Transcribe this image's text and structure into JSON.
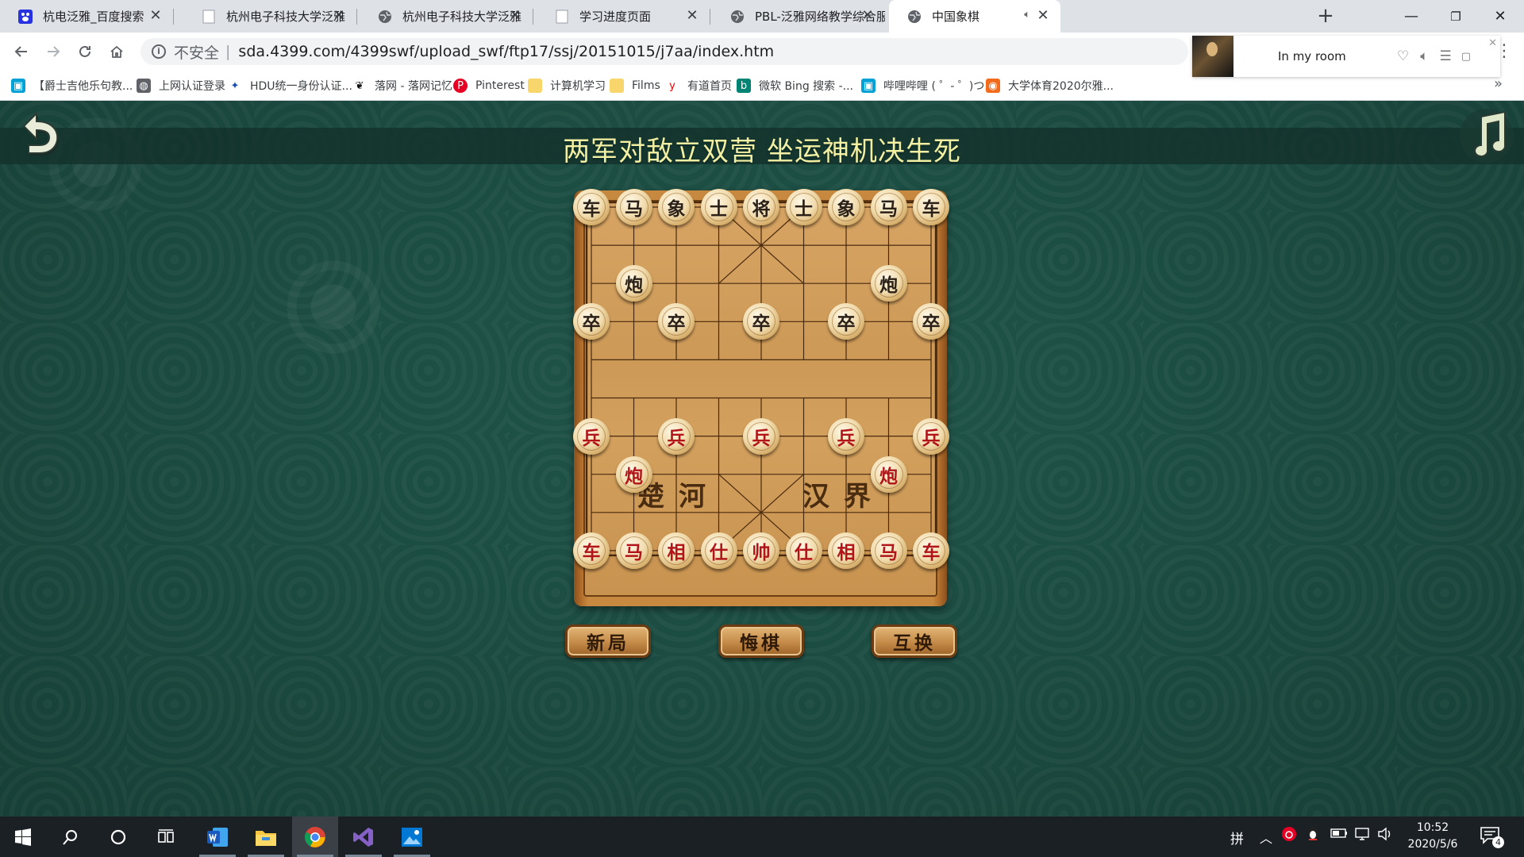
{
  "browser": {
    "tabs": [
      {
        "title": "杭电泛雅_百度搜索",
        "favicon": "baidu-paw-icon",
        "active": false
      },
      {
        "title": "杭州电子科技大学泛雅",
        "favicon": "blank-page-icon",
        "active": false
      },
      {
        "title": "杭州电子科技大学泛雅",
        "favicon": "globe-icon",
        "active": false
      },
      {
        "title": "学习进度页面",
        "favicon": "blank-page-icon",
        "active": false
      },
      {
        "title": "PBL-泛雅网络教学综合服务平台",
        "favicon": "globe-icon",
        "active": false
      },
      {
        "title": "中国象棋",
        "favicon": "globe-icon",
        "active": true,
        "playing_audio": true
      }
    ],
    "close_glyph": "✕",
    "new_tab_glyph": "+",
    "window_controls": {
      "minimize": "—",
      "restore": "❐",
      "close": "✕"
    },
    "address": {
      "security_label": "不安全",
      "separator": "|",
      "url": "sda.4399.com/4399swf/upload_swf/ftp17/ssj/20151015/j7aa/index.htm"
    },
    "bookmarks": [
      {
        "label": "【爵士吉他乐句教...",
        "icon": "bilibili-tv-icon"
      },
      {
        "label": "上网认证登录",
        "icon": "globe-icon"
      },
      {
        "label": "HDU统一身份认证...",
        "icon": "hdu-logo-icon"
      },
      {
        "label": "落网 - 落网记忆",
        "icon": "luowang-bird-icon"
      },
      {
        "label": "Pinterest",
        "icon": "pinterest-icon"
      },
      {
        "label": "计算机学习",
        "icon": "folder-icon"
      },
      {
        "label": "Films",
        "icon": "folder-icon"
      },
      {
        "label": "有道首页",
        "icon": "youdao-icon"
      },
      {
        "label": "微软 Bing 搜索 -...",
        "icon": "bing-icon"
      },
      {
        "label": "哔哩哔哩 ( ゜- ゜)つ...",
        "icon": "bilibili-tv-icon"
      },
      {
        "label": "大学体育2020尔雅...",
        "icon": "chaoxing-icon"
      }
    ],
    "bookmarks_more": "»"
  },
  "media_player": {
    "track_title": "In my room"
  },
  "game": {
    "title": "两军对敌立双营 坐运神机决生死",
    "river_left": "楚河",
    "river_right": "汉界",
    "buttons": {
      "new_game": "新局",
      "undo_move": "悔棋",
      "swap_sides": "互换"
    },
    "pieces": [
      {
        "side": "black",
        "char": "车",
        "col": 0,
        "row": 0
      },
      {
        "side": "black",
        "char": "马",
        "col": 1,
        "row": 0
      },
      {
        "side": "black",
        "char": "象",
        "col": 2,
        "row": 0
      },
      {
        "side": "black",
        "char": "士",
        "col": 3,
        "row": 0
      },
      {
        "side": "black",
        "char": "将",
        "col": 4,
        "row": 0
      },
      {
        "side": "black",
        "char": "士",
        "col": 5,
        "row": 0
      },
      {
        "side": "black",
        "char": "象",
        "col": 6,
        "row": 0
      },
      {
        "side": "black",
        "char": "马",
        "col": 7,
        "row": 0
      },
      {
        "side": "black",
        "char": "车",
        "col": 8,
        "row": 0
      },
      {
        "side": "black",
        "char": "炮",
        "col": 1,
        "row": 2
      },
      {
        "side": "black",
        "char": "炮",
        "col": 7,
        "row": 2
      },
      {
        "side": "black",
        "char": "卒",
        "col": 0,
        "row": 3
      },
      {
        "side": "black",
        "char": "卒",
        "col": 2,
        "row": 3
      },
      {
        "side": "black",
        "char": "卒",
        "col": 4,
        "row": 3
      },
      {
        "side": "black",
        "char": "卒",
        "col": 6,
        "row": 3
      },
      {
        "side": "black",
        "char": "卒",
        "col": 8,
        "row": 3
      },
      {
        "side": "red",
        "char": "兵",
        "col": 0,
        "row": 6
      },
      {
        "side": "red",
        "char": "兵",
        "col": 2,
        "row": 6
      },
      {
        "side": "red",
        "char": "兵",
        "col": 4,
        "row": 6
      },
      {
        "side": "red",
        "char": "兵",
        "col": 6,
        "row": 6
      },
      {
        "side": "red",
        "char": "兵",
        "col": 8,
        "row": 6
      },
      {
        "side": "red",
        "char": "炮",
        "col": 1,
        "row": 7
      },
      {
        "side": "red",
        "char": "炮",
        "col": 7,
        "row": 7
      },
      {
        "side": "red",
        "char": "车",
        "col": 0,
        "row": 9
      },
      {
        "side": "red",
        "char": "马",
        "col": 1,
        "row": 9
      },
      {
        "side": "red",
        "char": "相",
        "col": 2,
        "row": 9
      },
      {
        "side": "red",
        "char": "仕",
        "col": 3,
        "row": 9
      },
      {
        "side": "red",
        "char": "帅",
        "col": 4,
        "row": 9
      },
      {
        "side": "red",
        "char": "仕",
        "col": 5,
        "row": 9
      },
      {
        "side": "red",
        "char": "相",
        "col": 6,
        "row": 9
      },
      {
        "side": "red",
        "char": "马",
        "col": 7,
        "row": 9
      },
      {
        "side": "red",
        "char": "车",
        "col": 8,
        "row": 9
      }
    ]
  },
  "taskbar": {
    "apps": [
      {
        "name": "start-button",
        "icon": "windows-logo-icon"
      },
      {
        "name": "search-button",
        "icon": "search-icon"
      },
      {
        "name": "cortana-button",
        "icon": "cortana-circle-icon"
      },
      {
        "name": "task-view-button",
        "icon": "task-view-icon"
      },
      {
        "name": "word-app",
        "icon": "word-icon",
        "running": true
      },
      {
        "name": "file-explorer-app",
        "icon": "folder-icon",
        "running": true
      },
      {
        "name": "chrome-app",
        "icon": "chrome-icon",
        "running": true,
        "active": true
      },
      {
        "name": "visual-studio-app",
        "icon": "visual-studio-icon",
        "running": true
      },
      {
        "name": "photos-app",
        "icon": "photos-icon",
        "running": true
      }
    ],
    "tray": {
      "ime": "拼",
      "clock_time": "10:52",
      "clock_date": "2020/5/6",
      "notification_count": "4"
    }
  }
}
